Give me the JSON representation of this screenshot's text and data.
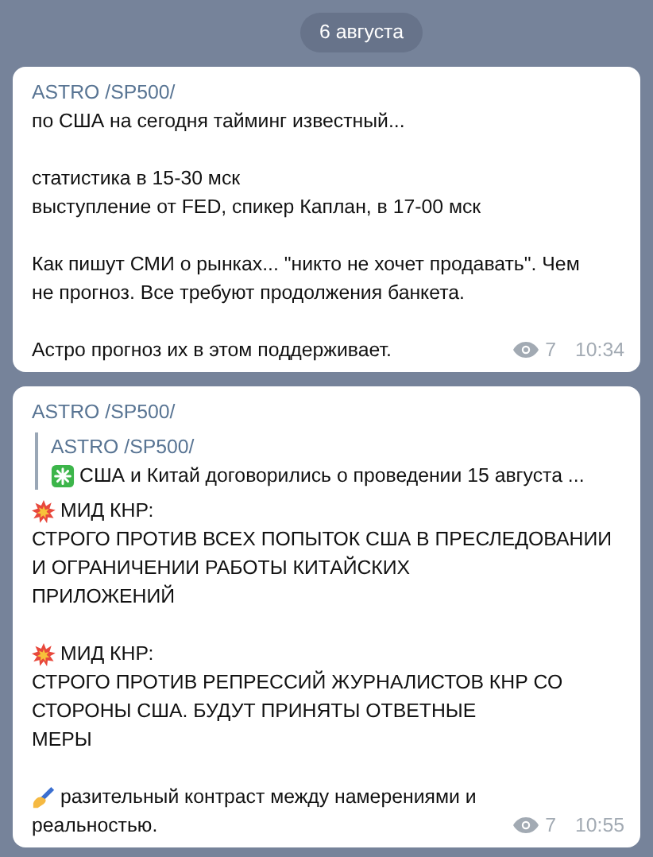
{
  "date_badge": "6 августа",
  "messages": [
    {
      "author": "ASTRO /SP500/",
      "paragraphs": [
        [
          {
            "kind": "text",
            "text": "по США на сегодня тайминг известный..."
          }
        ],
        [
          {
            "kind": "text",
            "text": "статистика в 15-30 мск"
          },
          {
            "kind": "text",
            "text": "выступление от FED, спикер Каплан, в 17-00 мск"
          }
        ],
        [
          {
            "kind": "text",
            "text": "Как пишут СМИ о рынках... \"никто не хочет продавать\". Чем"
          },
          {
            "kind": "text",
            "text": "не прогноз. Все требуют продолжения банкета."
          }
        ],
        [
          {
            "kind": "text",
            "text": "Астро прогноз их в этом поддерживает."
          }
        ]
      ],
      "views": "7",
      "time": "10:34"
    },
    {
      "author": "ASTRO /SP500/",
      "reply": {
        "author": "ASTRO /SP500/",
        "kind": "sparkle",
        "text": "США и Китай договорились о проведении 15 августа ..."
      },
      "paragraphs": [
        [
          {
            "kind": "burst",
            "text": "МИД КНР:"
          },
          {
            "kind": "text",
            "text": "СТРОГО ПРОТИВ ВСЕХ ПОПЫТОК США В ПРЕСЛЕДОВАНИИ"
          },
          {
            "kind": "text",
            "text": "И ОГРАНИЧЕНИИ РАБОТЫ КИТАЙСКИХ"
          },
          {
            "kind": "text",
            "text": "ПРИЛОЖЕНИЙ"
          }
        ],
        [
          {
            "kind": "burst",
            "text": "МИД КНР:"
          },
          {
            "kind": "text",
            "text": "СТРОГО ПРОТИВ РЕПРЕССИЙ ЖУРНАЛИСТОВ КНР СО"
          },
          {
            "kind": "text",
            "text": "СТОРОНЫ США. БУДУТ ПРИНЯТЫ ОТВЕТНЫЕ"
          },
          {
            "kind": "text",
            "text": "МЕРЫ"
          }
        ],
        [
          {
            "kind": "writing",
            "text": "разительный контраст между намерениями и"
          },
          {
            "kind": "text",
            "text": "реальностью."
          }
        ]
      ],
      "views": "7",
      "time": "10:55"
    }
  ]
}
